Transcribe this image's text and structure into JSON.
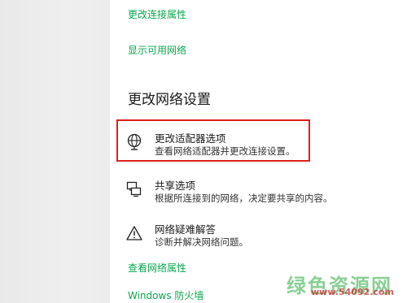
{
  "links": {
    "change_connection_properties": "更改连接属性",
    "show_available_networks": "显示可用网络",
    "view_network_properties": "查看网络属性",
    "windows_firewall": "Windows 防火墙"
  },
  "section": {
    "title": "更改网络设置"
  },
  "items": [
    {
      "title": "更改适配器选项",
      "desc": "查看网络适配器并更改连接设置。",
      "icon": "globe-monitor-icon"
    },
    {
      "title": "共享选项",
      "desc": "根据所连接到的网络，决定要共享的内容。",
      "icon": "sharing-icon"
    },
    {
      "title": "网络疑难解答",
      "desc": "诊断并解决网络问题。",
      "icon": "warning-icon"
    }
  ],
  "watermark": {
    "text": "绿色资源网",
    "url": "www.54092.com"
  },
  "colors": {
    "link": "#0aa84f",
    "highlight": "#e0201a"
  }
}
